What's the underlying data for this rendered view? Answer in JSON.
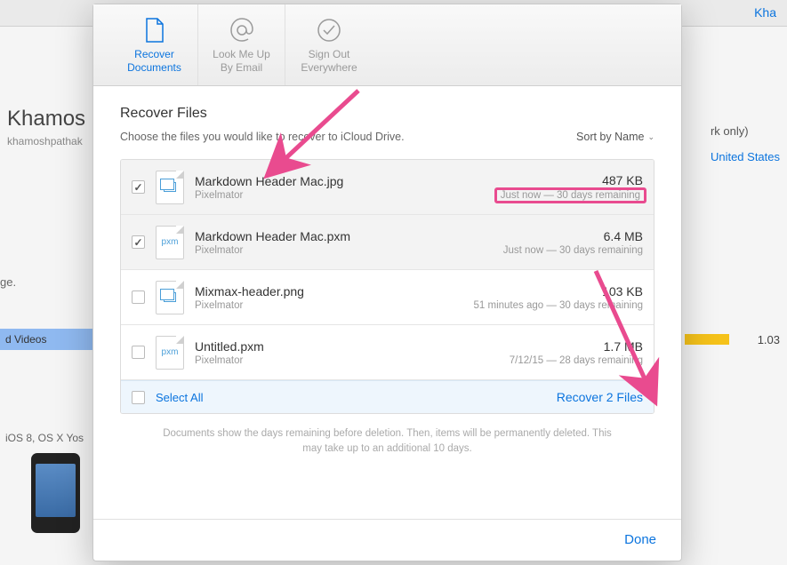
{
  "bg": {
    "topright": "Kha",
    "name": "Khamos",
    "email": "khamoshpathak",
    "network": "rk only)",
    "country": "United States",
    "text1": "ge.",
    "barlabel": "d Videos",
    "size": "1.03",
    "os": "iOS 8, OS X Yos"
  },
  "tabs": [
    {
      "label": "Recover Documents",
      "icon": "document",
      "active": true
    },
    {
      "label": "Look Me Up By Email",
      "icon": "at",
      "active": false
    },
    {
      "label": "Sign Out Everywhere",
      "icon": "check-circle",
      "active": false
    }
  ],
  "section": {
    "title": "Recover Files",
    "instruction": "Choose the files you would like to recover to iCloud Drive.",
    "sort_label": "Sort by Name"
  },
  "files": [
    {
      "name": "Markdown Header Mac.jpg",
      "app": "Pixelmator",
      "size": "487 KB",
      "time": "Just now — 30 days remaining",
      "checked": true,
      "icon": "image",
      "highlight_time": true
    },
    {
      "name": "Markdown Header Mac.pxm",
      "app": "Pixelmator",
      "size": "6.4 MB",
      "time": "Just now — 30 days remaining",
      "checked": true,
      "icon": "pxm",
      "highlight_time": false
    },
    {
      "name": "Mixmax-header.png",
      "app": "Pixelmator",
      "size": "103 KB",
      "time": "51 minutes ago — 30 days remaining",
      "checked": false,
      "icon": "image",
      "highlight_time": false
    },
    {
      "name": "Untitled.pxm",
      "app": "Pixelmator",
      "size": "1.7 MB",
      "time": "7/12/15 — 28 days remaining",
      "checked": false,
      "icon": "pxm",
      "highlight_time": false
    }
  ],
  "actions": {
    "select_all": "Select All",
    "recover": "Recover 2 Files"
  },
  "note": "Documents show the days remaining before deletion. Then, items will be permanently deleted. This may take up to an additional 10 days.",
  "done": "Done"
}
